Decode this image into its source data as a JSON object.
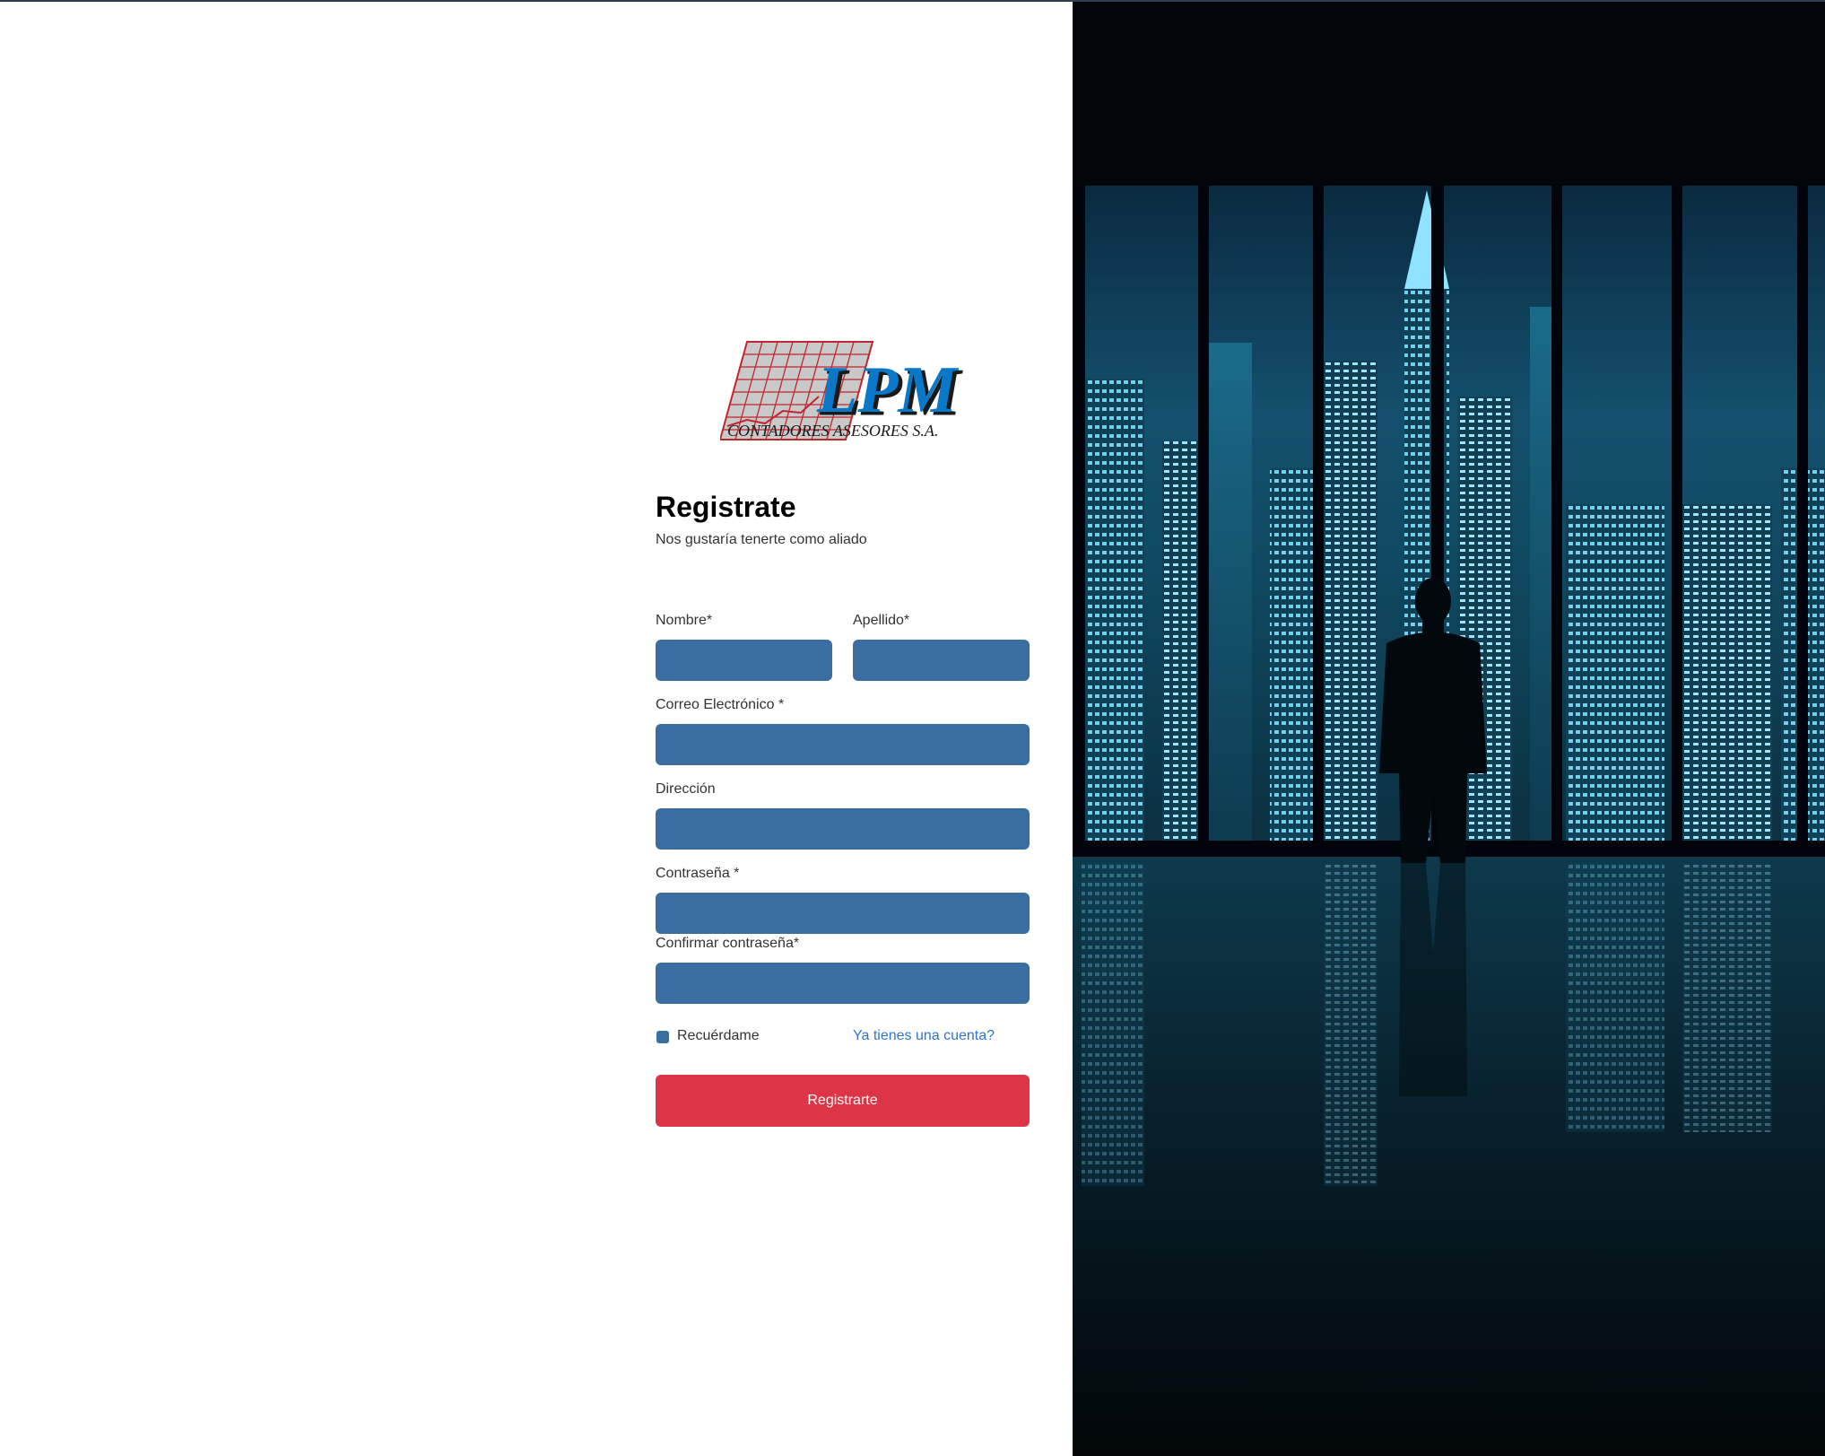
{
  "brand": {
    "logo_text": "LPM",
    "logo_subtitle": "CONTADORES ASESORES S.A.",
    "logo_name": "lpm-logo"
  },
  "header": {
    "title": "Registrate",
    "subtitle": "Nos gustaría tenerte como aliado"
  },
  "form": {
    "first_name": {
      "label": "Nombre*",
      "value": ""
    },
    "last_name": {
      "label": "Apellido*",
      "value": ""
    },
    "email": {
      "label": "Correo Electrónico *",
      "value": ""
    },
    "address": {
      "label": "Dirección",
      "value": ""
    },
    "password": {
      "label": "Contraseña *",
      "value": ""
    },
    "confirm_password": {
      "label": "Confirmar contraseña*",
      "value": ""
    },
    "remember_me": {
      "label": "Recuérdame",
      "checked": true
    },
    "login_link": "Ya tienes una cuenta?",
    "submit_label": "Registrarte"
  },
  "colors": {
    "input_bg": "#3b6ea0",
    "submit_bg": "#dc3545",
    "link": "#2f74d0",
    "logo_blue": "#0a78c8",
    "logo_red": "#c0262d"
  },
  "background_image": "night-city-skyline-with-silhouette"
}
